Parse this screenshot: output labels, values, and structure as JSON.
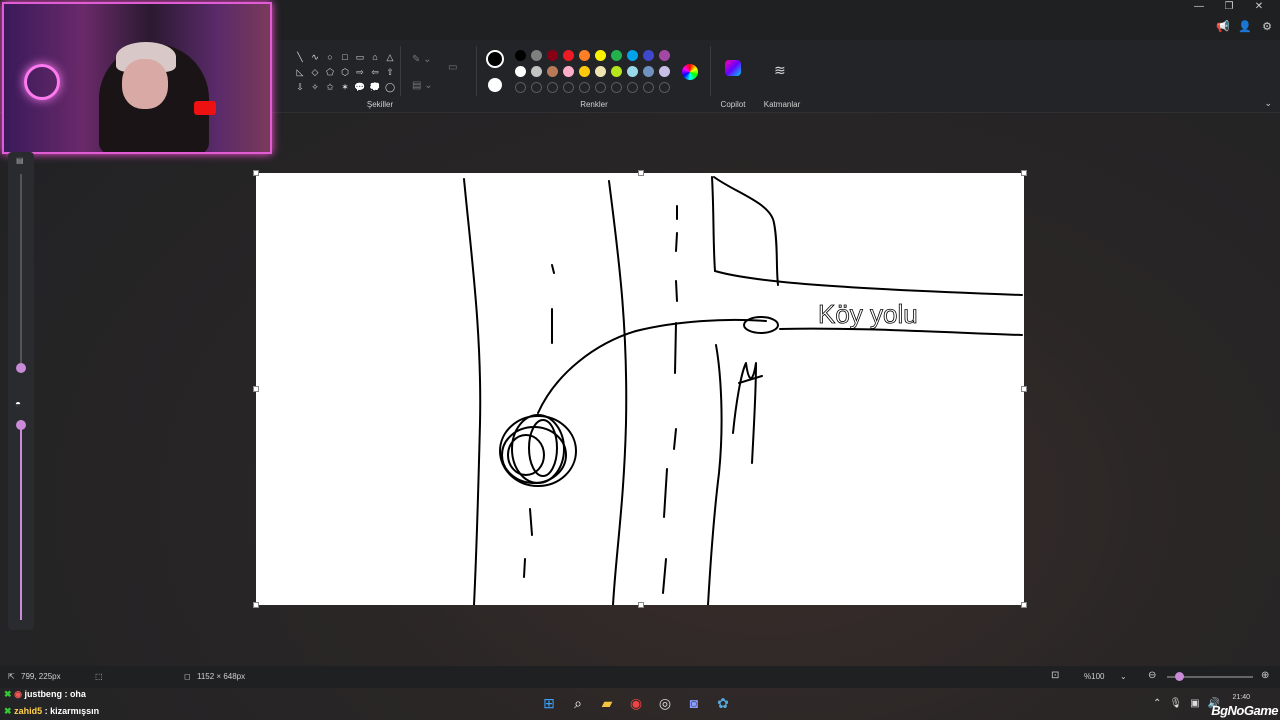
{
  "window": {
    "controls": [
      "—",
      "❐",
      "✕"
    ],
    "top_icons": [
      "📢",
      "👤",
      "⚙"
    ]
  },
  "ribbon": {
    "shapes_label": "Şekiller",
    "colors_label": "Renkler",
    "copilot_label": "Copilot",
    "layers_label": "Katmanlar",
    "shape_glyphs": [
      "╲",
      "∿",
      "○",
      "□",
      "▭",
      "⌂",
      "△",
      "◺",
      "◇",
      "⬠",
      "⬡",
      "⇨",
      "⇦",
      "⇧",
      "⇩",
      "✧",
      "✩",
      "✶",
      "💬",
      "💭",
      "◯"
    ],
    "primary_color": "#000000",
    "secondary_color": "#ffffff",
    "swatches": [
      "#000000",
      "#7f7f7f",
      "#880015",
      "#ed1c24",
      "#ff7f27",
      "#fff200",
      "#22b14c",
      "#00a2e8",
      "#3f48cc",
      "#a349a4",
      "#ffffff",
      "#c3c3c3",
      "#b97a57",
      "#ffaec9",
      "#ffc90e",
      "#efe4b0",
      "#b5e61d",
      "#99d9ea",
      "#7092be",
      "#c8bfe7"
    ]
  },
  "canvas": {
    "handwritten_text": "Köy yolu"
  },
  "status": {
    "cursor_pos": "799, 225px",
    "canvas_size": "1152 × 648px",
    "zoom": "%100"
  },
  "chat": [
    {
      "user": "justbeng",
      "message": "oha"
    },
    {
      "user": "zahid5",
      "message": "kizarmışsın"
    }
  ],
  "taskbar": {
    "time": "21:40",
    "watermark": "BgNoGame"
  }
}
